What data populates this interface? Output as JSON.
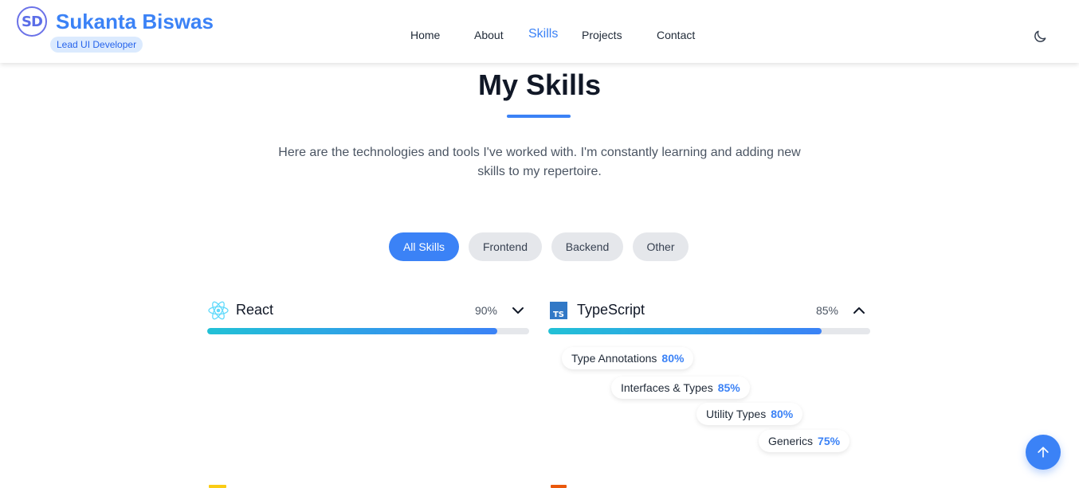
{
  "brand": {
    "logo_text": "SD",
    "name": "Sukanta Biswas",
    "role": "Lead UI Developer"
  },
  "nav": [
    {
      "label": "Home",
      "active": false
    },
    {
      "label": "About",
      "active": false
    },
    {
      "label": "Skills",
      "active": true
    },
    {
      "label": "Projects",
      "active": false
    },
    {
      "label": "Contact",
      "active": false
    }
  ],
  "theme_toggle_icon": "moon-icon",
  "section": {
    "title": "My Skills",
    "intro": "Here are the technologies and tools I've worked with. I'm constantly learning and adding new skills to my repertoire."
  },
  "filters": [
    {
      "label": "All Skills",
      "active": true
    },
    {
      "label": "Frontend",
      "active": false
    },
    {
      "label": "Backend",
      "active": false
    },
    {
      "label": "Other",
      "active": false
    }
  ],
  "skills": [
    {
      "name": "React",
      "percent_label": "90%",
      "level": 0.9,
      "icon": "react-icon",
      "expanded": false,
      "accent": "#61dafb"
    },
    {
      "name": "TypeScript",
      "percent_label": "85%",
      "level": 0.85,
      "icon": "typescript-icon",
      "expanded": true,
      "accent": "#3178c6",
      "subskills": [
        {
          "name": "Type Annotations",
          "value": "80%"
        },
        {
          "name": "Interfaces & Types",
          "value": "85%"
        },
        {
          "name": "Utility Types",
          "value": "80%"
        },
        {
          "name": "Generics",
          "value": "75%"
        }
      ]
    }
  ],
  "colors": {
    "accent": "#3b82f6",
    "bar_start": "#22c1d6",
    "bar_end": "#3b82f6"
  },
  "scroll_top_icon": "arrow-up-icon"
}
